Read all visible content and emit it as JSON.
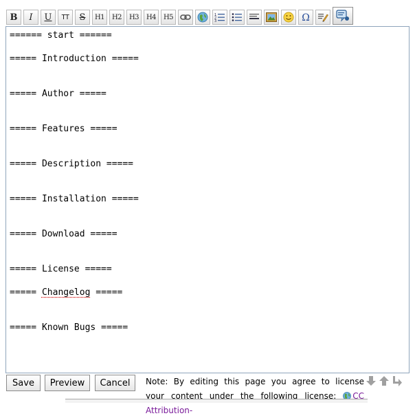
{
  "toolbar": {
    "bold": "B",
    "italic": "I",
    "underline": "U",
    "monospace": "TT",
    "strike": "S",
    "h1": "H1",
    "h2": "H2",
    "h3": "H3",
    "h4": "H4",
    "h5": "H5",
    "icons": [
      "link-icon",
      "external-link-icon",
      "ordered-list-icon",
      "unordered-list-icon",
      "horizontal-rule-icon",
      "image-icon",
      "smiley-icon",
      "special-chars-icon",
      "signature-icon",
      "insert-snippet-icon"
    ]
  },
  "editor": {
    "lines": [
      "====== start ======",
      "",
      "===== Introduction =====",
      "",
      "",
      "===== Author =====",
      "",
      "",
      "===== Features =====",
      "",
      "",
      "===== Description =====",
      "",
      "",
      "===== Installation =====",
      "",
      "",
      "===== Download =====",
      "",
      "",
      "===== License =====",
      "",
      "===== ",
      "",
      "",
      "===== Known Bugs ====="
    ],
    "changelog_prefix": "===== ",
    "changelog_word": "Changelog",
    "changelog_suffix": " ====="
  },
  "buttons": {
    "save": "Save",
    "preview": "Preview",
    "cancel": "Cancel"
  },
  "license": {
    "note": "Note: By editing this page you agree to license your content under the following license:",
    "link": "CC Attribution-"
  },
  "colors": {
    "editor_border": "#8ea4bb",
    "link": "#7a1b9a",
    "resize_arrows": "#9a9a9a"
  }
}
